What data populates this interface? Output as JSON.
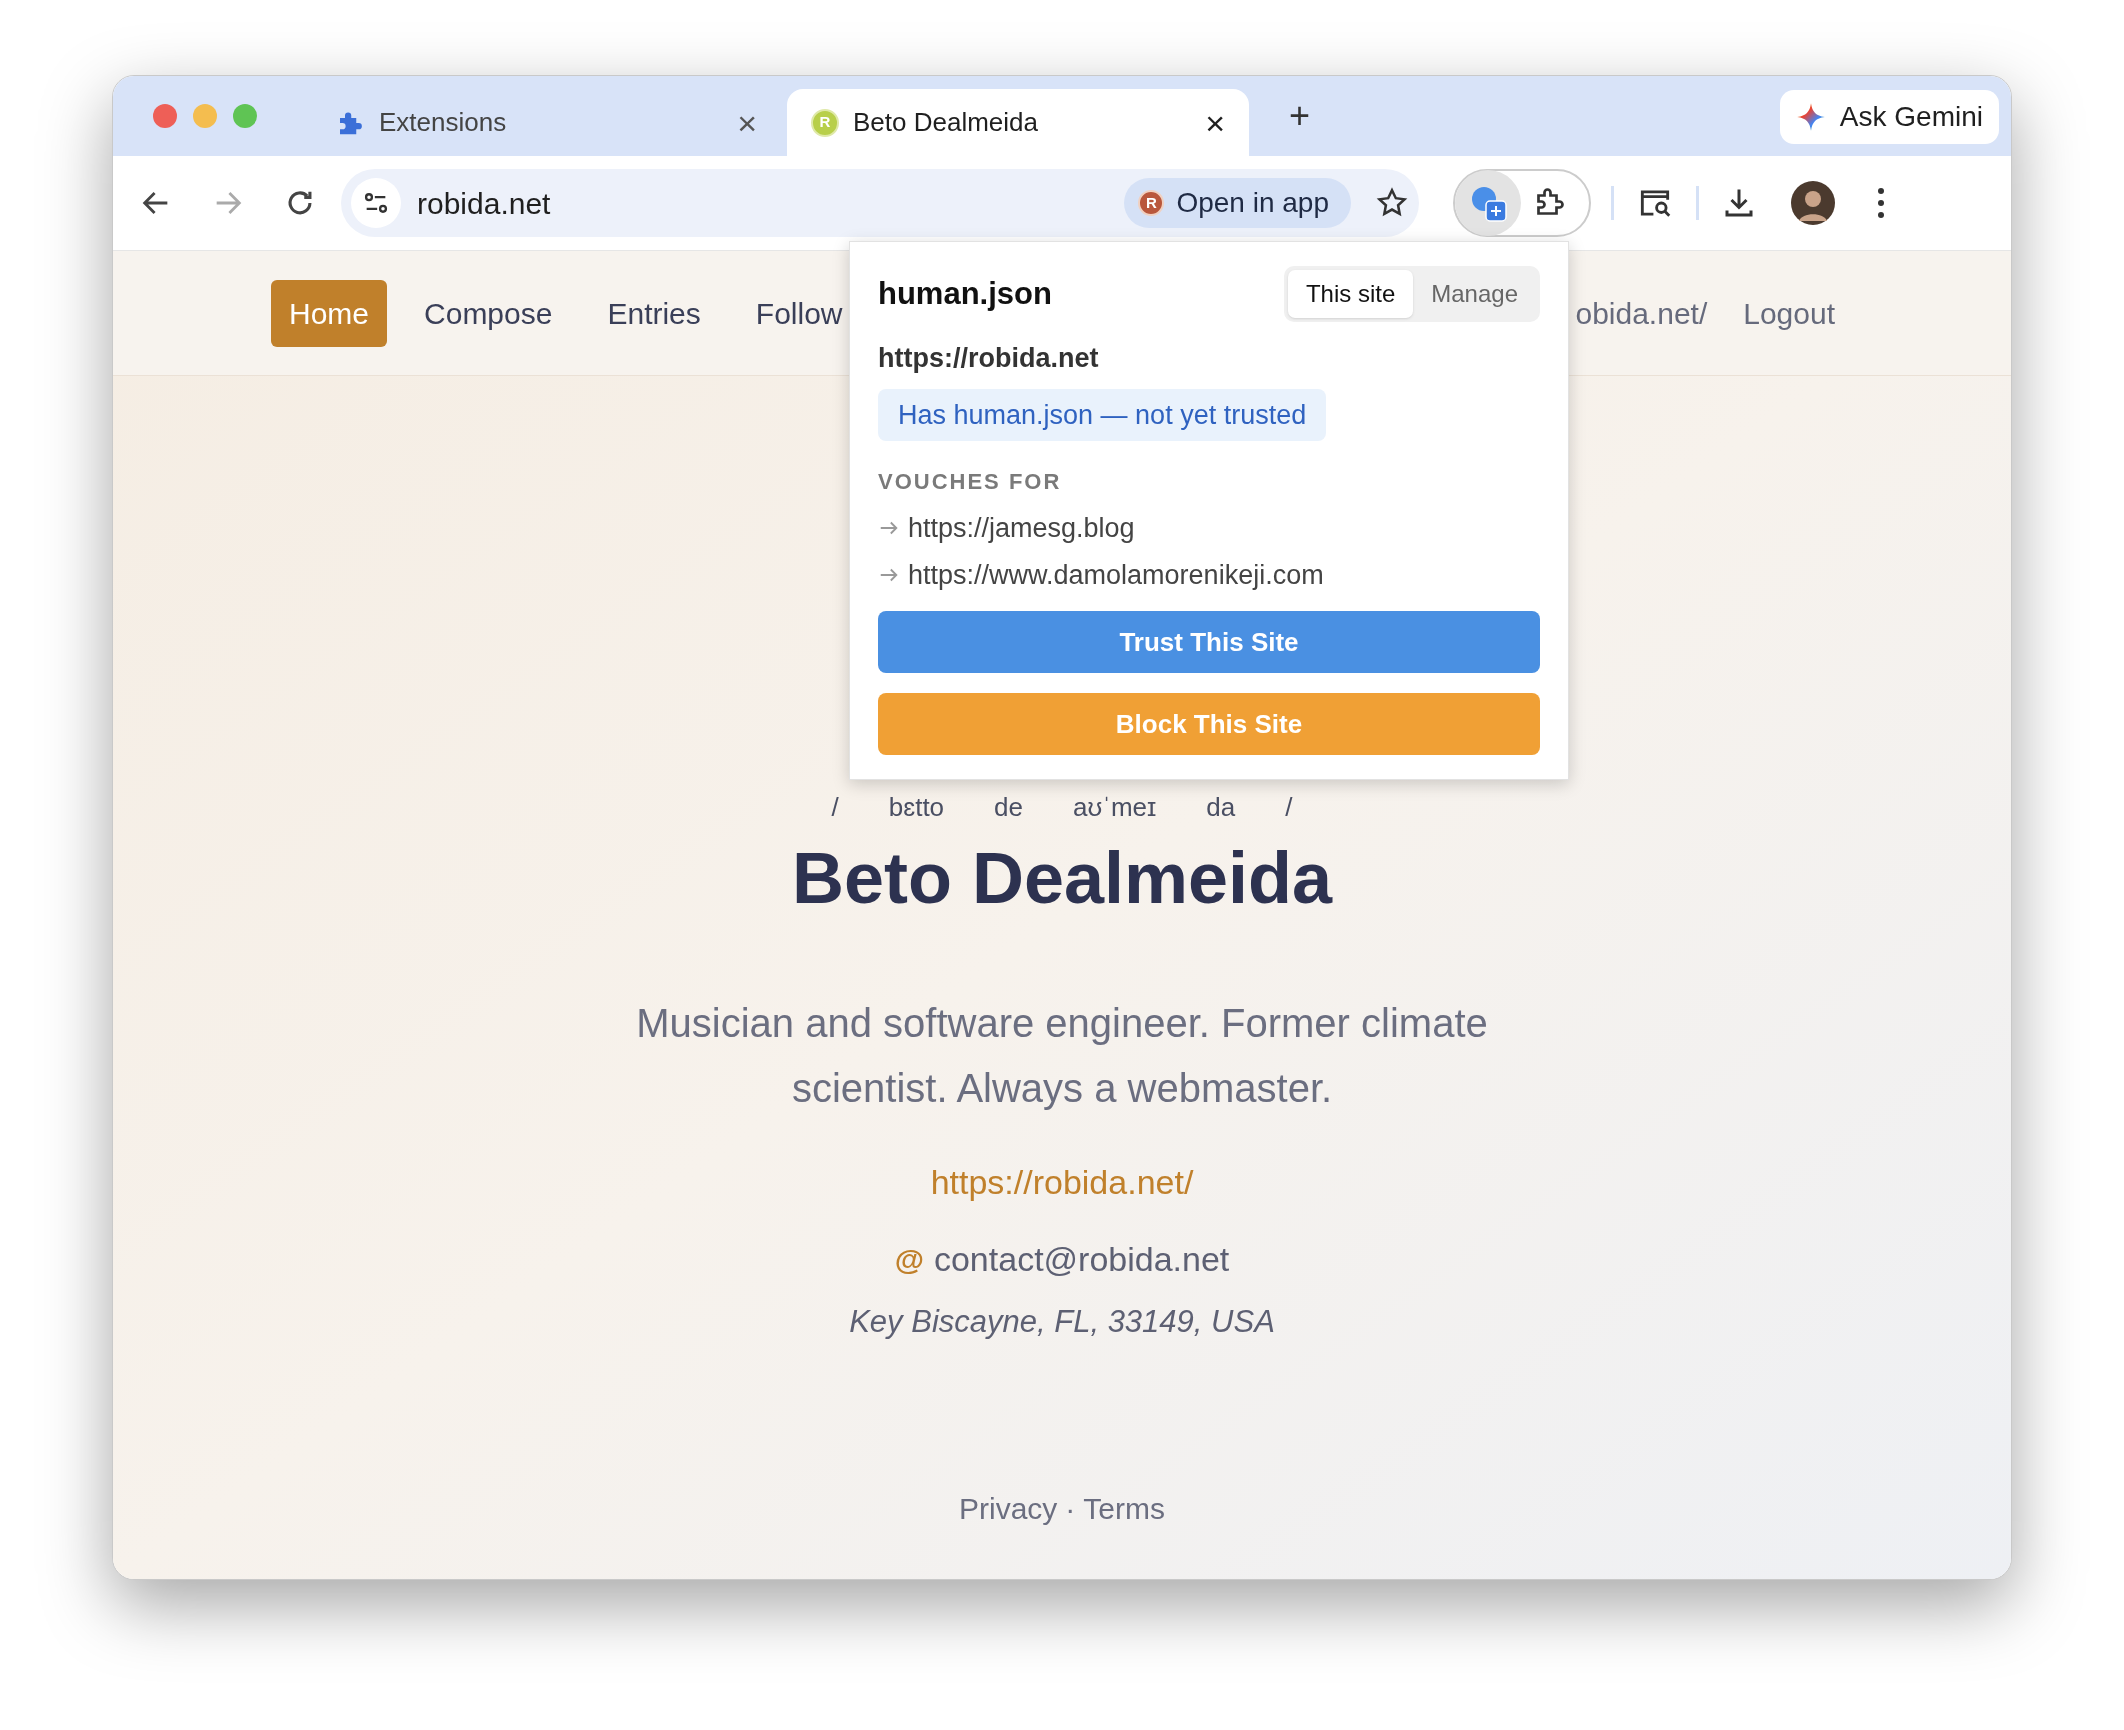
{
  "browser": {
    "tabs": [
      {
        "kind": "extensions",
        "title": "Extensions",
        "selected": false,
        "close": "×"
      },
      {
        "kind": "site",
        "favicon_letter": "R",
        "title": "Beto Dealmeida",
        "selected": true,
        "close": "×"
      }
    ],
    "new_tab": "+",
    "ask_gemini": "Ask Gemini",
    "address": "robida.net",
    "open_in_app": {
      "icon_letter": "R",
      "label": "Open in app"
    }
  },
  "nav": [
    {
      "label": "Home",
      "selected": true
    },
    {
      "label": "Compose",
      "selected": false
    },
    {
      "label": "Entries",
      "selected": false
    },
    {
      "label": "Follow",
      "selected": false
    },
    {
      "label": "obida.net/",
      "selected": false
    },
    {
      "label": "Logout",
      "selected": false
    }
  ],
  "popup": {
    "title": "human.json",
    "segments": [
      {
        "label": "This site",
        "selected": true
      },
      {
        "label": "Manage",
        "selected": false
      }
    ],
    "site": "https://robida.net",
    "status": "Has human.json — not yet trusted",
    "section": "VOUCHES FOR",
    "vouches": [
      "https://jamesg.blog",
      "https://www.damolamorenikeji.com"
    ],
    "buttons": [
      {
        "kind": "trust",
        "label": "Trust This Site"
      },
      {
        "kind": "block",
        "label": "Block This Site"
      }
    ]
  },
  "profile": {
    "pronunciation": [
      "/",
      "bɛtto",
      "de",
      "aʊˈmeɪ",
      "da",
      "/"
    ],
    "name": "Beto Dealmeida",
    "bio": "Musician and software engineer. Former climate scientist. Always a webmaster.",
    "website": "https://robida.net/",
    "email_icon": "@",
    "email": "contact@robida.net",
    "location": "Key Biscayne, FL, 33149, USA"
  },
  "footer": {
    "links": [
      "Privacy",
      "Terms"
    ],
    "separator": "·"
  }
}
